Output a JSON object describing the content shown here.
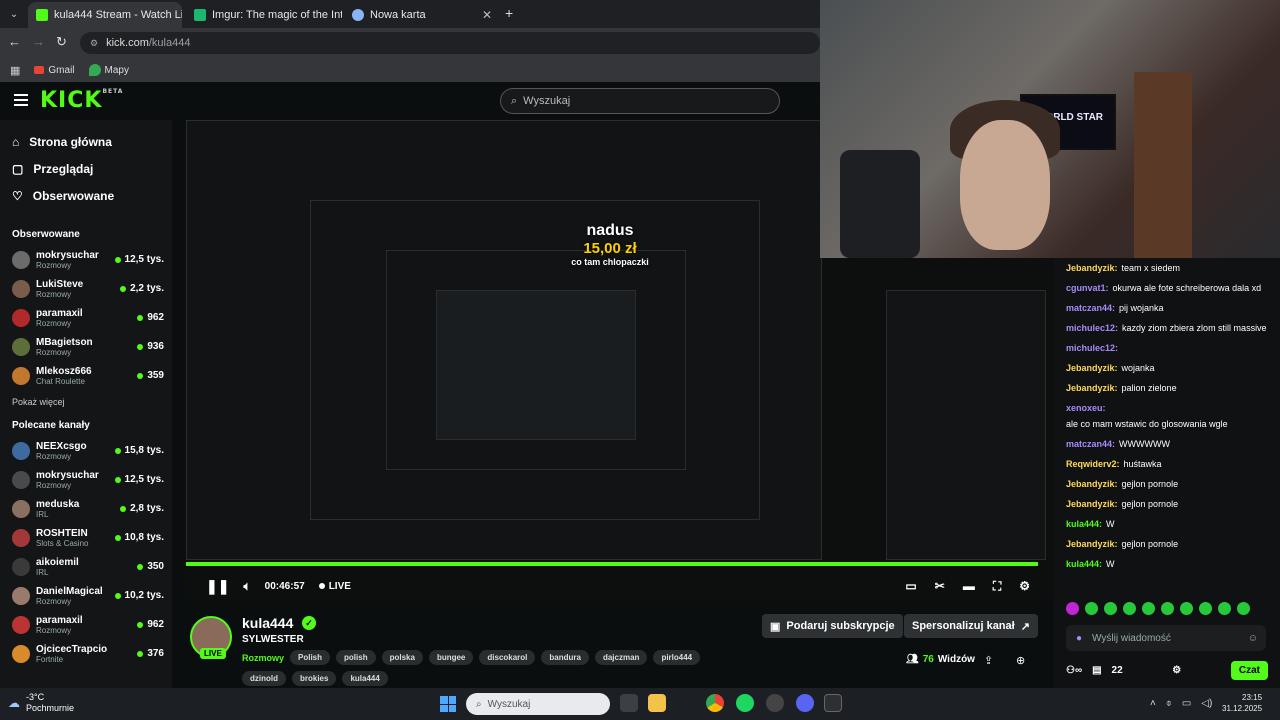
{
  "browser": {
    "tabs": [
      {
        "label": "kula444 Stream - Watch Li…",
        "active": true
      },
      {
        "label": "Imgur: The magic of the Interne…",
        "active": false
      },
      {
        "label": "Nowa karta",
        "active": false
      }
    ],
    "url_host": "kick.com",
    "url_path": "/kula444",
    "bookmarks": [
      "Gmail",
      "Mapy"
    ]
  },
  "site": {
    "logo": "KICK",
    "logo_sup": "BETA",
    "search_placeholder": "Wyszukaj"
  },
  "sidebar": {
    "nav": [
      {
        "label": "Strona główna",
        "icon": "home-icon"
      },
      {
        "label": "Przeglądaj",
        "icon": "browse-icon"
      },
      {
        "label": "Obserwowane",
        "icon": "heart-icon"
      }
    ],
    "followed_heading": "Obserwowane",
    "followed": [
      {
        "name": "mokrysuchar",
        "category": "Rozmowy",
        "viewers": "12,5 tys."
      },
      {
        "name": "LukiSteve",
        "category": "Rozmowy",
        "viewers": "2,2 tys."
      },
      {
        "name": "paramaxil",
        "category": "Rozmowy",
        "viewers": "962"
      },
      {
        "name": "MBagietson",
        "category": "Rozmowy",
        "viewers": "936"
      },
      {
        "name": "Mlekosz666",
        "category": "Chat Roulette",
        "viewers": "359"
      }
    ],
    "show_more": "Pokaż więcej",
    "recommended_heading": "Polecane kanały",
    "recommended": [
      {
        "name": "NEEXcsgo",
        "category": "Rozmowy",
        "viewers": "15,8 tys."
      },
      {
        "name": "mokrysuchar",
        "category": "Rozmowy",
        "viewers": "12,5 tys."
      },
      {
        "name": "meduska",
        "category": "IRL",
        "viewers": "2,8 tys."
      },
      {
        "name": "ROSHTEIN",
        "category": "Slots & Casino",
        "viewers": "10,8 tys."
      },
      {
        "name": "aikoiemil",
        "category": "IRL",
        "viewers": "350"
      },
      {
        "name": "DanielMagical",
        "category": "Rozmowy",
        "viewers": "10,2 tys."
      },
      {
        "name": "paramaxil",
        "category": "Rozmowy",
        "viewers": "962"
      },
      {
        "name": "OjcicecTrapcio",
        "category": "Fortnite",
        "viewers": "376"
      }
    ]
  },
  "player": {
    "time": "00:46:57",
    "live_label": "LIVE",
    "donation_name": "nadus",
    "donation_amount": "15,00 zł",
    "donation_message": "co tam chlopaczki",
    "webcam_tv_text": "WORLD STAR"
  },
  "stream": {
    "streamer": "kula444",
    "title": "SYLWESTER",
    "category": "Rozmowy",
    "live_badge": "LIVE",
    "tags": [
      "Polish",
      "polish",
      "polska",
      "bungee",
      "discokarol",
      "bandura",
      "dajczman",
      "pirlo444",
      "dzinold",
      "brokies",
      "kula444"
    ],
    "sub_button": "Podaruj subskrypcje",
    "personalize_button": "Spersonalizuj kanał",
    "viewers_count": "76",
    "viewers_label": "Widzów"
  },
  "chat": {
    "messages": [
      {
        "user": "Jebandyzik",
        "text": "team x siedem",
        "color": "#ffd95a"
      },
      {
        "user": "cgunvat1",
        "text": "okurwa ale fote schreiberowa dala xd",
        "color": "#a78bfa"
      },
      {
        "user": "matczan44",
        "text": "pij wojanka",
        "color": "#a78bfa"
      },
      {
        "user": "michulec12",
        "text": "kazdy ziom zbiera zlom still massive",
        "color": "#a78bfa"
      },
      {
        "user": "michulec12",
        "text": "",
        "color": "#a78bfa"
      },
      {
        "user": "Jebandyzik",
        "text": "wojanka",
        "color": "#ffd95a"
      },
      {
        "user": "Jebandyzik",
        "text": "palion zielone",
        "color": "#ffd95a"
      },
      {
        "user": "xenoxeu",
        "text": "ale co mam wstawic do glosowania wgle",
        "color": "#a78bfa"
      },
      {
        "user": "matczan44",
        "text": "WWWWWW",
        "color": "#a78bfa"
      },
      {
        "user": "Reqwiderv2",
        "text": "huśtawka",
        "color": "#ffd95a"
      },
      {
        "user": "Jebandyzik",
        "text": "gejlon pornole",
        "color": "#ffd95a"
      },
      {
        "user": "Jebandyzik",
        "text": "gejlon pornole",
        "color": "#ffd95a"
      },
      {
        "user": "kula444",
        "text": "W",
        "color": "#53fc18"
      },
      {
        "user": "Jebandyzik",
        "text": "gejlon pornole",
        "color": "#ffd95a"
      },
      {
        "user": "kula444",
        "text": "W",
        "color": "#53fc18"
      }
    ],
    "input_placeholder": "Wyślij wiadomość",
    "points": "22",
    "send_label": "Czat"
  },
  "taskbar": {
    "temp": "-3°C",
    "weather": "Pochmurnie",
    "search": "Wyszukaj",
    "time": "23:15",
    "date": "31.12.2025"
  },
  "colors": {
    "accent": "#53fc18",
    "bg": "#0b0e0f",
    "panel": "#141517"
  }
}
